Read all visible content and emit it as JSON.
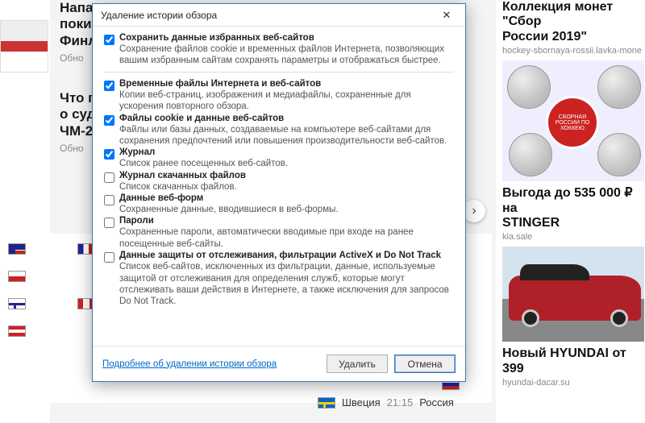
{
  "background": {
    "news1": {
      "line1": "Напа…",
      "line2": "поки…",
      "line3": "Финл…",
      "meta": "Обно"
    },
    "news2": {
      "line1": "Что п…",
      "line2": "о суд…",
      "line3": "ЧМ-2…",
      "meta": "Обно"
    },
    "arrow_glyph": "›",
    "match": {
      "team1": "Швеция",
      "time": "21:15",
      "team2": "Россия"
    }
  },
  "dialog": {
    "title": "Удаление истории обзора",
    "close_glyph": "✕",
    "options": [
      {
        "checked": true,
        "title": "Сохранить данные избранных веб-сайтов",
        "desc": "Сохранение файлов cookie и временных файлов Интернета, позволяющих вашим избранным сайтам сохранять параметры и отображаться быстрее."
      },
      {
        "checked": true,
        "title": "Временные файлы Интернета и веб-сайтов",
        "desc": "Копии веб-страниц, изображения и медиафайлы, сохраненные для ускорения повторного обзора."
      },
      {
        "checked": true,
        "title": "Файлы cookie и данные веб-сайтов",
        "desc": "Файлы или базы данных, создаваемые на компьютере веб-сайтами для сохранения предпочтений или повышения производительности веб-сайтов."
      },
      {
        "checked": true,
        "title": "Журнал",
        "desc": "Список ранее посещенных веб-сайтов."
      },
      {
        "checked": false,
        "title": "Журнал скачанных файлов",
        "desc": "Список скачанных файлов."
      },
      {
        "checked": false,
        "title": "Данные веб-форм",
        "desc": "Сохраненные данные, вводившиеся в веб-формы."
      },
      {
        "checked": false,
        "title": "Пароли",
        "desc": "Сохраненные пароли, автоматически вводимые при входе на ранее посещенные веб-сайты."
      },
      {
        "checked": false,
        "title": "Данные защиты от отслеживания, фильтрации ActiveX и Do Not Track",
        "desc": "Список веб-сайтов, исключенных из фильтрации, данные, используемые защитой от отслеживания для определения служб, которые могут отслеживать ваши действия в Интернете, а также исключения для запросов Do Not Track."
      }
    ],
    "more_link": "Подробнее об удалении истории обзора",
    "btn_delete": "Удалить",
    "btn_cancel": "Отмена"
  },
  "ads": {
    "ad1": {
      "title_a": "Коллекция монет \"Сбор",
      "title_b": "России 2019\"",
      "sub": "hockey-sbornaya-rossii.lavka-mone",
      "badge": "СБОРНАЯ РОССИИ ПО ХОККЕЮ"
    },
    "ad2": {
      "line1": "Выгода до 535 000 ₽ на",
      "brand": "STINGER",
      "sub": "kia.sale"
    },
    "ad3": {
      "title": "Новый HYUNDAI от 399",
      "sub": "hyundai-dacar.su"
    }
  }
}
